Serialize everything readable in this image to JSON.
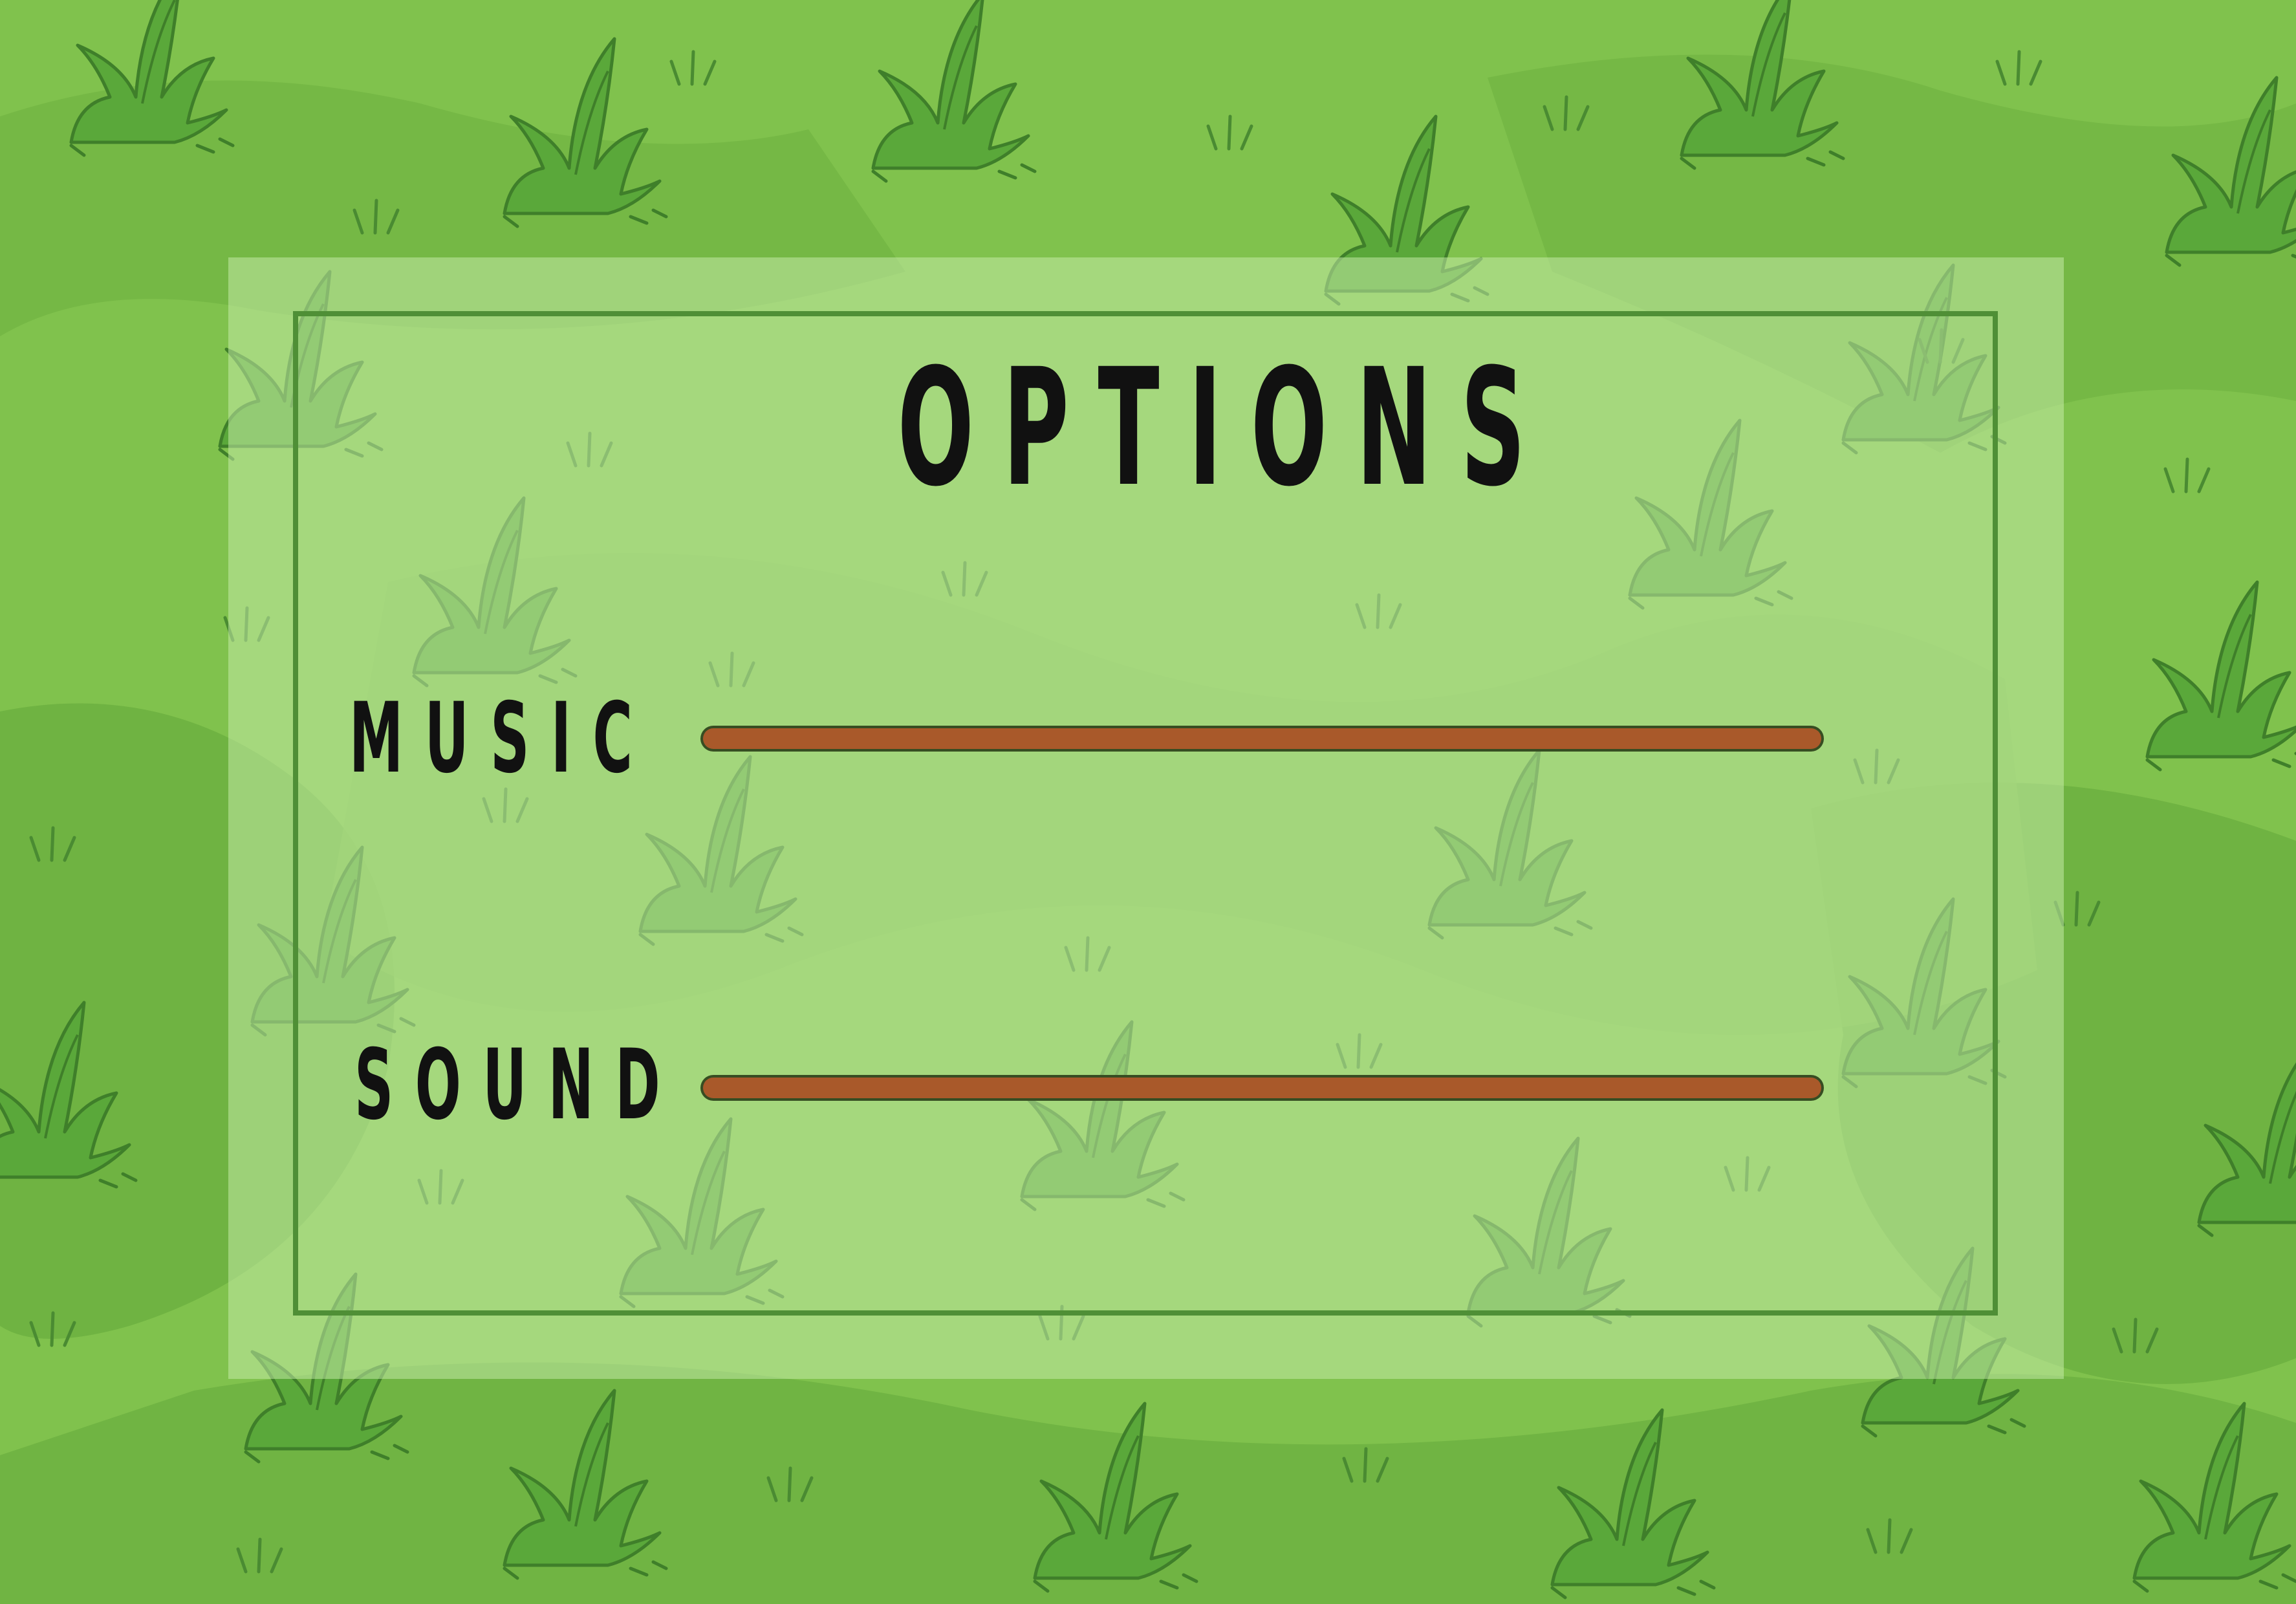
{
  "screen": {
    "title": "OPTIONS"
  },
  "options": [
    {
      "label": "MUSIC",
      "level": 1.0
    },
    {
      "label": "SOUND",
      "level": 1.0
    }
  ],
  "colors": {
    "grass_background": "#7fc24c",
    "panel_overlay": "#c8ebaa",
    "frame_border": "#4f8f36",
    "slider_fill": "#a9592a",
    "slider_outline": "#374d22",
    "text": "#111111"
  },
  "icons": [
    "grass-tuft-icon"
  ]
}
